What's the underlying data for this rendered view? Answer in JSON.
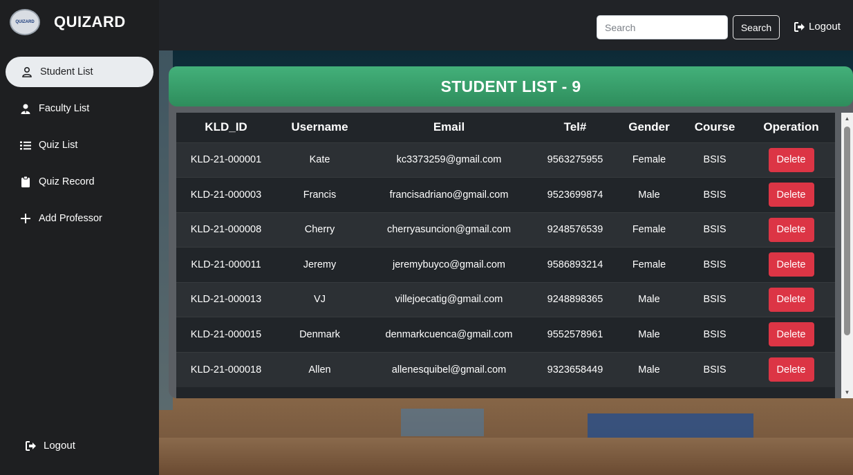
{
  "app": {
    "logo_text": "QUIZARD",
    "name": "QUIZARD"
  },
  "sidebar": {
    "items": [
      {
        "label": "Student List",
        "icon": "user-icon",
        "active": true
      },
      {
        "label": "Faculty List",
        "icon": "user-tie-icon",
        "active": false
      },
      {
        "label": "Quiz List",
        "icon": "list-icon",
        "active": false
      },
      {
        "label": "Quiz Record",
        "icon": "clipboard-icon",
        "active": false
      },
      {
        "label": "Add Professor",
        "icon": "plus-icon",
        "active": false
      }
    ],
    "logout_label": "Logout"
  },
  "topbar": {
    "search_placeholder": "Search",
    "search_button": "Search",
    "logout_label": "Logout"
  },
  "card": {
    "title": "STUDENT LIST - 9"
  },
  "table": {
    "headers": [
      "KLD_ID",
      "Username",
      "Email",
      "Tel#",
      "Gender",
      "Course",
      "Operation"
    ],
    "delete_label": "Delete",
    "rows": [
      [
        "KLD-21-000001",
        "Kate",
        "kc3373259@gmail.com",
        "9563275955",
        "Female",
        "BSIS"
      ],
      [
        "KLD-21-000003",
        "Francis",
        "francisadriano@gmail.com",
        "9523699874",
        "Male",
        "BSIS"
      ],
      [
        "KLD-21-000008",
        "Cherry",
        "cherryasuncion@gmail.com",
        "9248576539",
        "Female",
        "BSIS"
      ],
      [
        "KLD-21-000011",
        "Jeremy",
        "jeremybuyco@gmail.com",
        "9586893214",
        "Female",
        "BSIS"
      ],
      [
        "KLD-21-000013",
        "VJ",
        "villejoecatig@gmail.com",
        "9248898365",
        "Male",
        "BSIS"
      ],
      [
        "KLD-21-000015",
        "Denmark",
        "denmarkcuenca@gmail.com",
        "9552578961",
        "Male",
        "BSIS"
      ],
      [
        "KLD-21-000018",
        "Allen",
        "allenesquibel@gmail.com",
        "9323658449",
        "Male",
        "BSIS"
      ]
    ]
  },
  "colors": {
    "header_green": "#3aa06c",
    "delete_red": "#dc3545",
    "sidebar_bg": "#1e1f21",
    "table_bg": "#212529"
  }
}
